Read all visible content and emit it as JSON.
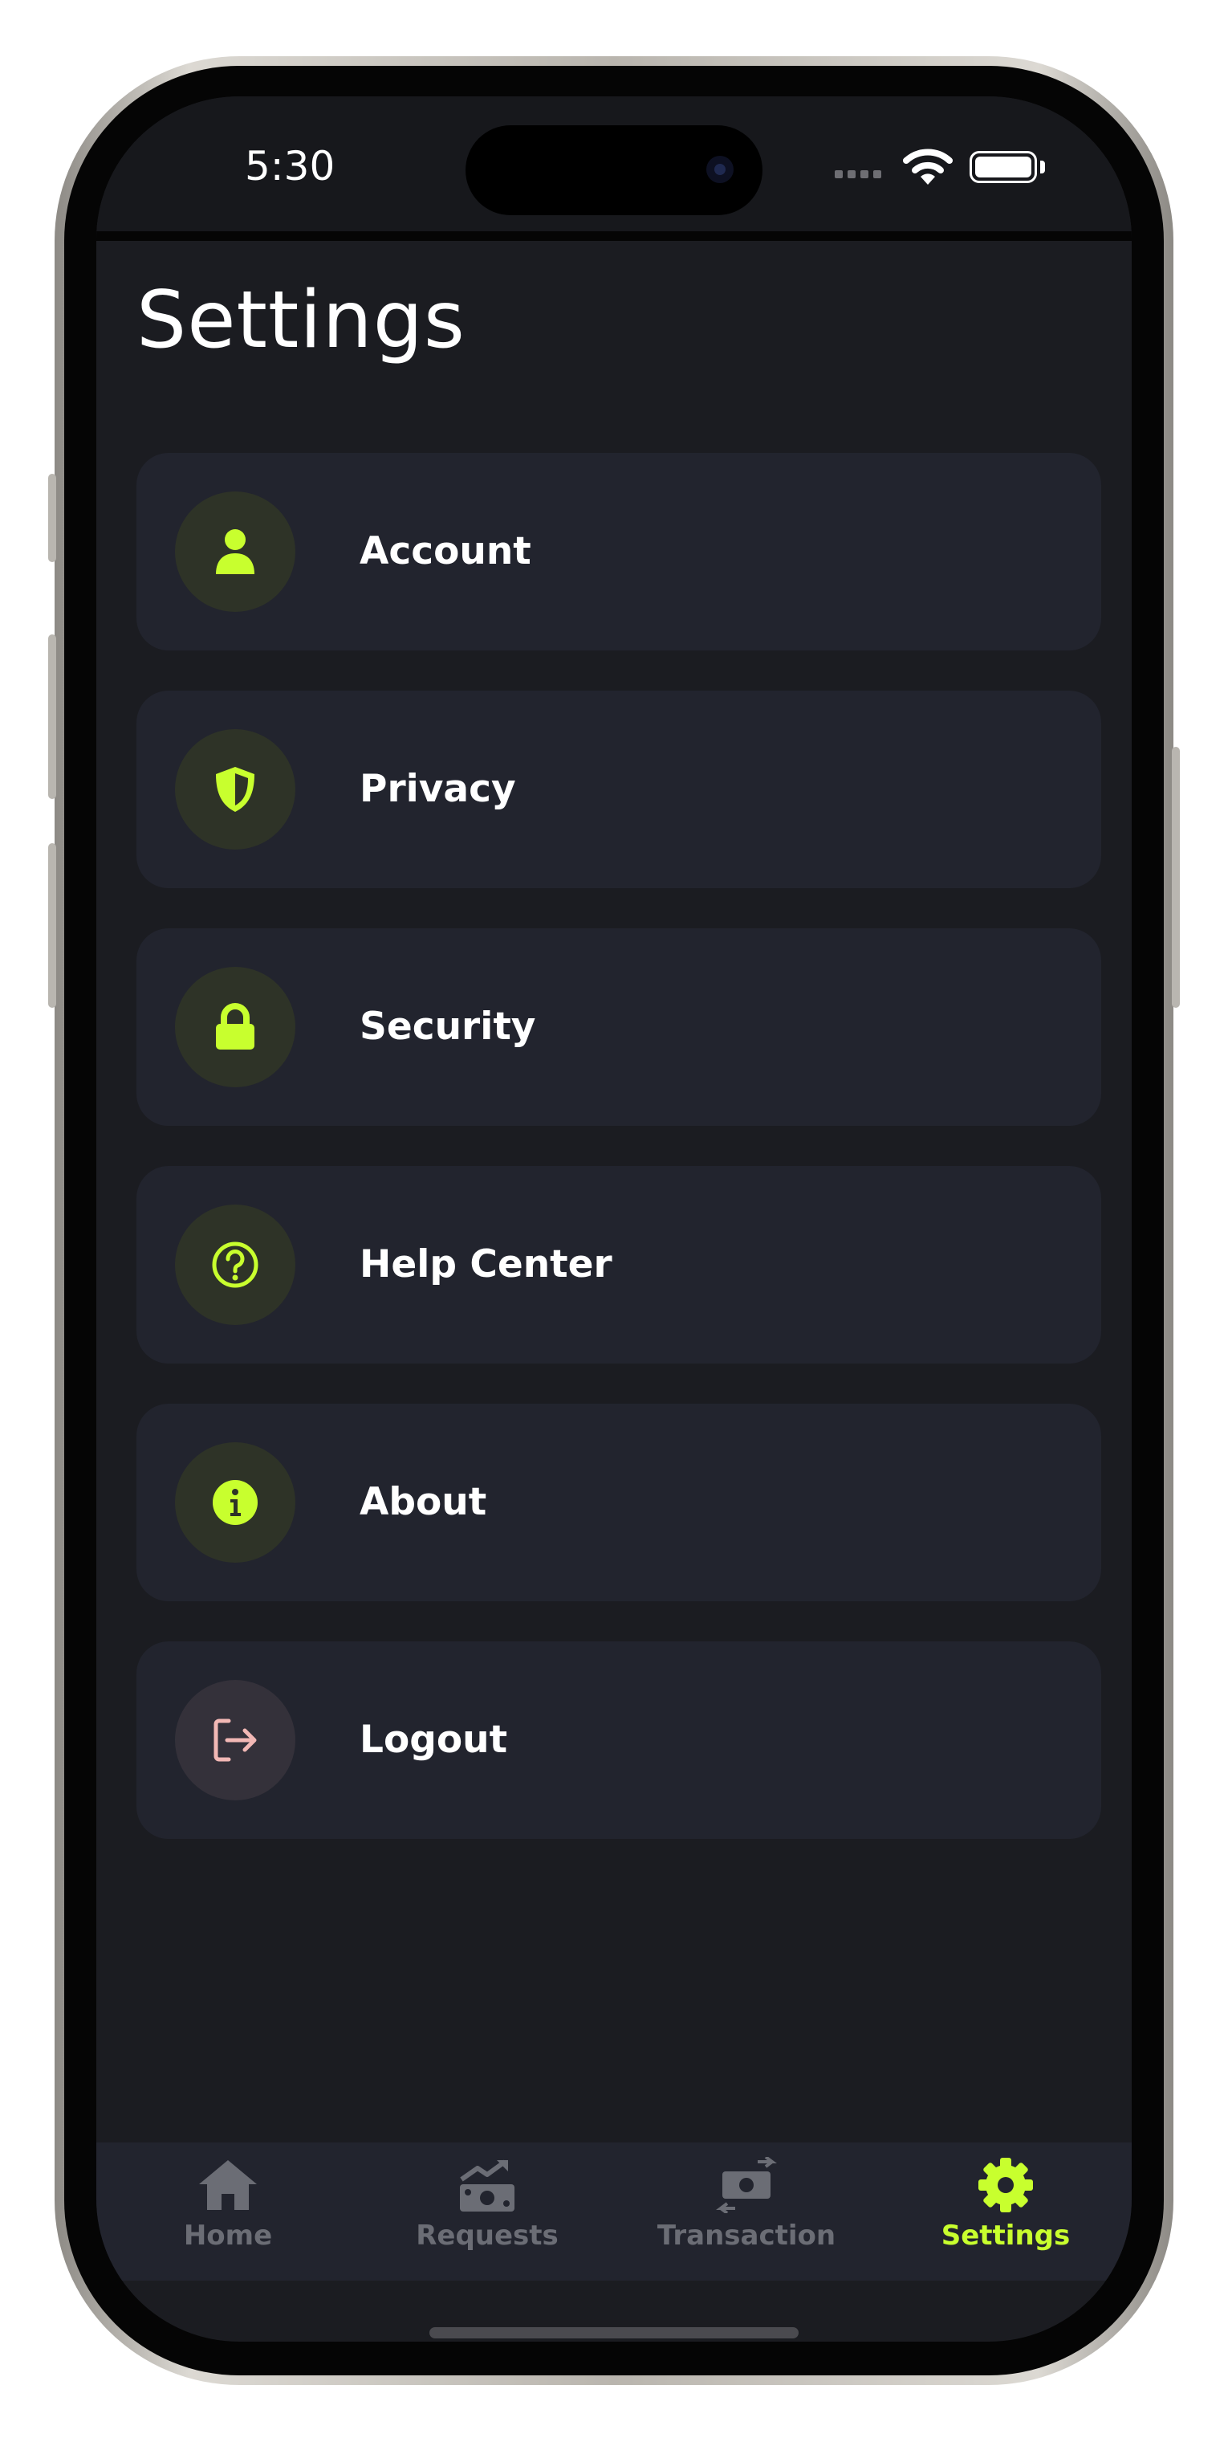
{
  "status_bar": {
    "time": "5:30"
  },
  "page": {
    "title": "Settings"
  },
  "colors": {
    "accent": "#c8ff2e",
    "logout": "#f2b8b5",
    "card": "#22242e",
    "background": "#1b1c21",
    "inactive": "#6b6d75"
  },
  "menu": {
    "items": [
      {
        "label": "Account",
        "icon": "person-icon"
      },
      {
        "label": "Privacy",
        "icon": "shield-icon"
      },
      {
        "label": "Security",
        "icon": "lock-icon"
      },
      {
        "label": "Help Center",
        "icon": "question-circle-icon"
      },
      {
        "label": "About",
        "icon": "info-icon"
      },
      {
        "label": "Logout",
        "icon": "logout-icon"
      }
    ]
  },
  "bottom_nav": {
    "items": [
      {
        "label": "Home",
        "icon": "home-icon",
        "active": false
      },
      {
        "label": "Requests",
        "icon": "money-trend-icon",
        "active": false
      },
      {
        "label": "Transaction",
        "icon": "money-exchange-icon",
        "active": false
      },
      {
        "label": "Settings",
        "icon": "gear-icon",
        "active": true
      }
    ]
  }
}
